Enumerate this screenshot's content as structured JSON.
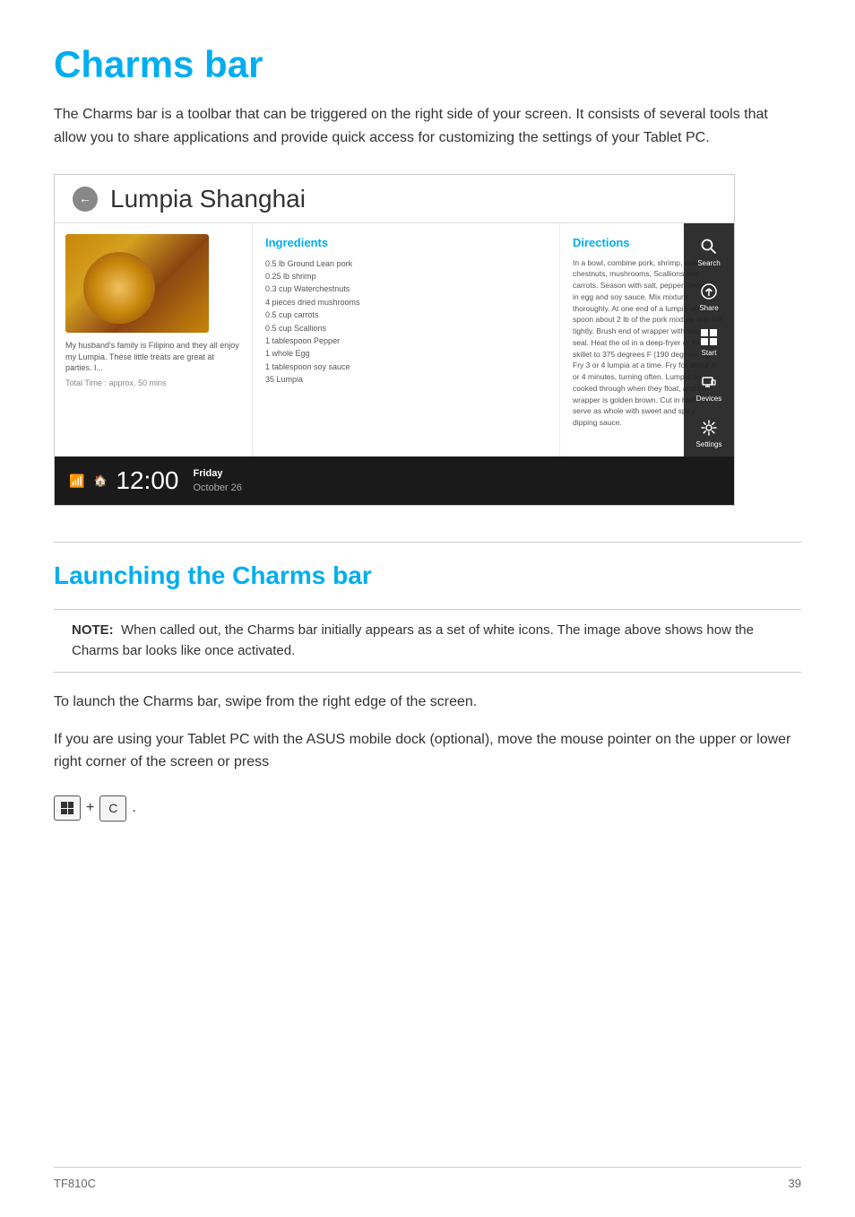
{
  "page": {
    "title": "Charms bar",
    "intro": "The Charms bar is a toolbar that can be triggered on the right side of your screen. It consists of several tools that allow you to share applications and provide quick access for customizing the settings of your Tablet PC.",
    "model": "TF810C",
    "page_number": "39"
  },
  "screenshot": {
    "app_title": "Lumpia Shanghai",
    "back_button": "←",
    "food_description": "My husband's family is Filipino and they all enjoy my Lumpia. These little treats are great at parties. I...",
    "total_time": "Total Time : approx. 50 mins",
    "ingredients_heading": "Ingredients",
    "ingredients": [
      "0.5 lb Ground Lean pork",
      "0.25 lb shrimp",
      "0.3 cup Waterchestnuts",
      "4 pieces dried mushrooms",
      "0.5 cup carrots",
      "0.5 cup Scallions",
      "1 tablespoon Pepper",
      "1 whole Egg",
      "1 tablespoon soy sauce",
      "35 Lumpia"
    ],
    "directions_heading": "Directions",
    "directions": "In a bowl, combine pork, shrimp, water-chestnuts, mushrooms, Scallions and carrots. Season with salt, pepper, then mix in egg and soy sauce. Mix mixture thoroughly. At one end of a lumpia wrapper, spoon about 2 lb of the pork mixture and roll tightly. Brush end of wrapper with water to seal. Heat the oil in a deep-fryer or heavy skillet to 375 degrees F (190 degrees C). Fry 3 or 4 lumpia at a time. Fry for about 3 or 4 minutes, turning often. Lumpia are cooked through when they float, and the wrapper is golden brown. Cut in half, or serve as whole with sweet and spicy dipping sauce.",
    "charms": [
      {
        "label": "Search",
        "icon": "search"
      },
      {
        "label": "Share",
        "icon": "share"
      },
      {
        "label": "Start",
        "icon": "start"
      },
      {
        "label": "Devices",
        "icon": "devices"
      },
      {
        "label": "Settings",
        "icon": "settings"
      }
    ],
    "time": "12:00",
    "day": "Friday",
    "date": "October 26"
  },
  "launching_section": {
    "heading": "Launching the Charms bar",
    "note_label": "NOTE:",
    "note_text": "When called out, the Charms bar initially appears as a set of white icons. The image above shows how the Charms bar looks like once activated.",
    "body1": "To launch the Charms bar, swipe from the right edge of the screen.",
    "body2": "If you are using your Tablet PC with the ASUS mobile dock (optional), move the mouse pointer on the upper or lower right corner of the screen or press",
    "key_win": "⊞",
    "key_plus": "+",
    "key_c": "C"
  }
}
